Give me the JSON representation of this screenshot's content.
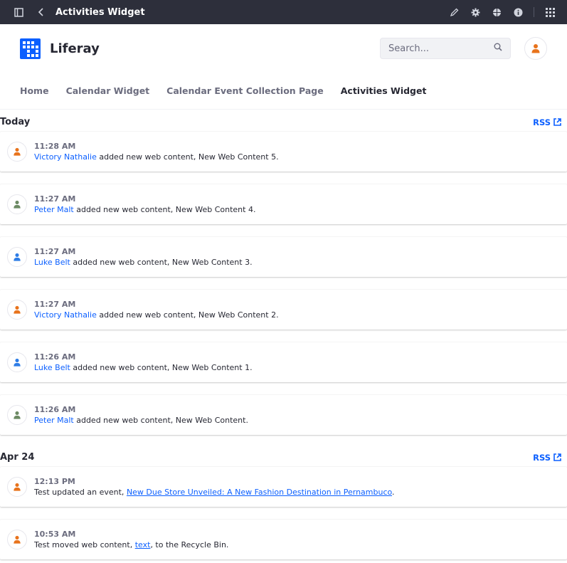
{
  "topbar": {
    "title": "Activities Widget",
    "icons": [
      "sidebar-toggle-icon",
      "back-chevron-icon",
      "pencil-icon",
      "gear-icon",
      "simulation-icon",
      "info-icon",
      "apps-grid-icon"
    ]
  },
  "header": {
    "brand": "Liferay",
    "search_placeholder": "Search...",
    "colors": {
      "brand_blue": "#0b5fff",
      "avatar_orange": "#e8731c"
    }
  },
  "nav": {
    "items": [
      {
        "label": "Home",
        "active": false
      },
      {
        "label": "Calendar Widget",
        "active": false
      },
      {
        "label": "Calendar Event Collection Page",
        "active": false
      },
      {
        "label": "Activities Widget",
        "active": true
      }
    ]
  },
  "sections": [
    {
      "date": "Today",
      "rss_label": "RSS",
      "activities": [
        {
          "time": "11:28 AM",
          "user": "Victory Nathalie",
          "text": " added new web content, New Web Content 5.",
          "avatar_color": "#e8731c"
        },
        {
          "time": "11:27 AM",
          "user": "Peter Malt",
          "text": " added new web content, New Web Content 4.",
          "avatar_color": "#6c8a63"
        },
        {
          "time": "11:27 AM",
          "user": "Luke Belt",
          "text": " added new web content, New Web Content 3.",
          "avatar_color": "#2e7de6"
        },
        {
          "time": "11:27 AM",
          "user": "Victory Nathalie",
          "text": " added new web content, New Web Content 2.",
          "avatar_color": "#e8731c"
        },
        {
          "time": "11:26 AM",
          "user": "Luke Belt",
          "text": " added new web content, New Web Content 1.",
          "avatar_color": "#2e7de6"
        },
        {
          "time": "11:26 AM",
          "user": "Peter Malt",
          "text": " added new web content, New Web Content.",
          "avatar_color": "#6c8a63"
        }
      ]
    },
    {
      "date": "Apr 24",
      "rss_label": "RSS",
      "activities": [
        {
          "time": "12:13 PM",
          "prefix": "Test updated an event, ",
          "link": "New Due Store Unveiled: A New Fashion Destination in Pernambuco",
          "suffix": ".",
          "avatar_color": "#e8731c"
        },
        {
          "time": "10:53 AM",
          "prefix": "Test moved web content, ",
          "link": "text",
          "suffix": ", to the Recycle Bin.",
          "avatar_color": "#e8731c"
        }
      ]
    }
  ]
}
